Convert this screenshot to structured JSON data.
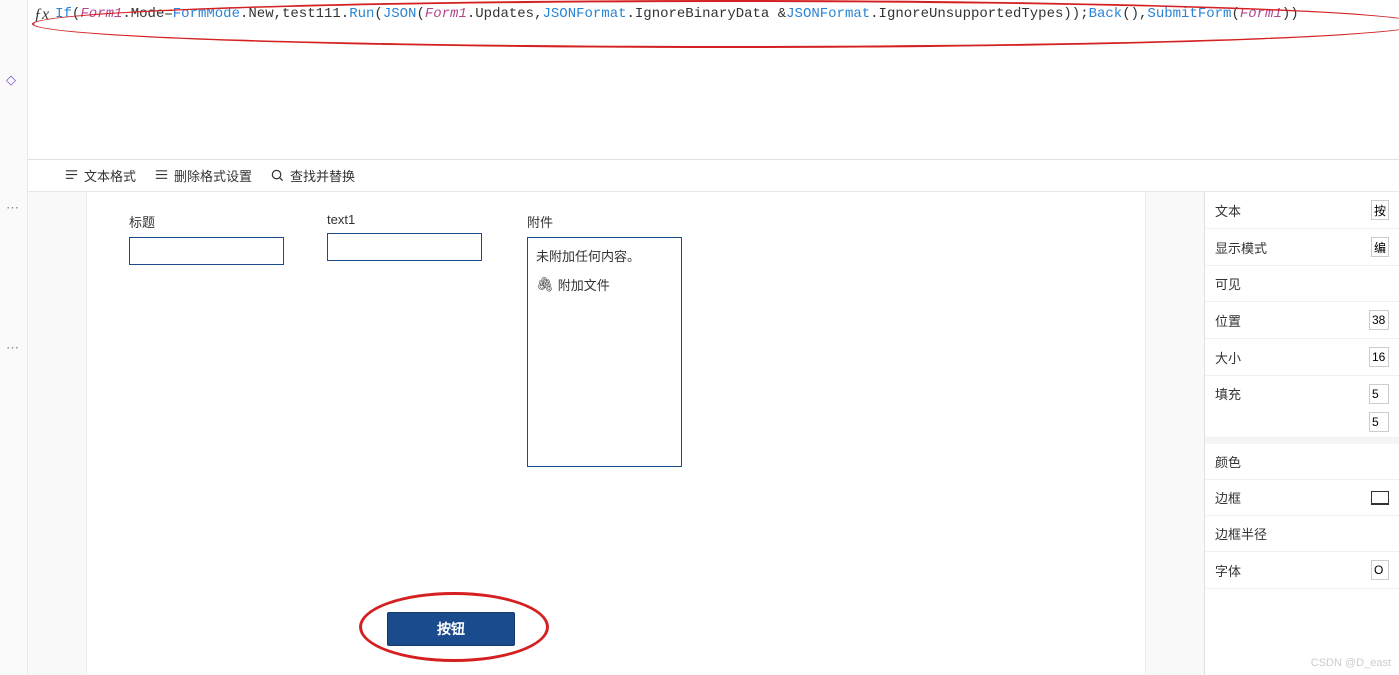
{
  "formula": {
    "tokens": [
      {
        "t": "If",
        "c": "kw"
      },
      {
        "t": "(",
        "c": "plain"
      },
      {
        "t": "Form1",
        "c": "var"
      },
      {
        "t": ".Mode=",
        "c": "plain"
      },
      {
        "t": "FormMode",
        "c": "kw"
      },
      {
        "t": ".New,test111.",
        "c": "plain"
      },
      {
        "t": "Run",
        "c": "kw"
      },
      {
        "t": "(",
        "c": "plain"
      },
      {
        "t": "JSON",
        "c": "kw"
      },
      {
        "t": "(",
        "c": "plain"
      },
      {
        "t": "Form1",
        "c": "var"
      },
      {
        "t": ".Updates,",
        "c": "plain"
      },
      {
        "t": "JSONFormat",
        "c": "kw"
      },
      {
        "t": ".IgnoreBinaryData &",
        "c": "plain"
      },
      {
        "t": "JSONFormat",
        "c": "kw"
      },
      {
        "t": ".IgnoreUnsupportedTypes));",
        "c": "plain"
      },
      {
        "t": "Back",
        "c": "kw"
      },
      {
        "t": "(),",
        "c": "plain"
      },
      {
        "t": "SubmitForm",
        "c": "kw"
      },
      {
        "t": "(",
        "c": "plain"
      },
      {
        "t": "Form1",
        "c": "var"
      },
      {
        "t": "))",
        "c": "plain"
      }
    ]
  },
  "toolbar": {
    "text_format": "文本格式",
    "remove_format": "删除格式设置",
    "find_replace": "查找并替换"
  },
  "form": {
    "title_label": "标题",
    "text1_label": "text1",
    "attach_label": "附件",
    "attach_empty": "未附加任何内容。",
    "attach_action": "附加文件",
    "button_label": "按钮"
  },
  "props": {
    "text_label": "文本",
    "text_value": "按",
    "display_mode_label": "显示模式",
    "display_mode_value": "编",
    "visible_label": "可见",
    "position_label": "位置",
    "position_value": "38",
    "size_label": "大小",
    "size_value": "16",
    "padding_label": "填充",
    "padding_top": "5",
    "padding_bottom": "5",
    "color_label": "颜色",
    "border_label": "边框",
    "border_radius_label": "边框半径",
    "font_label": "字体",
    "font_value": "O"
  },
  "watermark": "CSDN @D_east"
}
